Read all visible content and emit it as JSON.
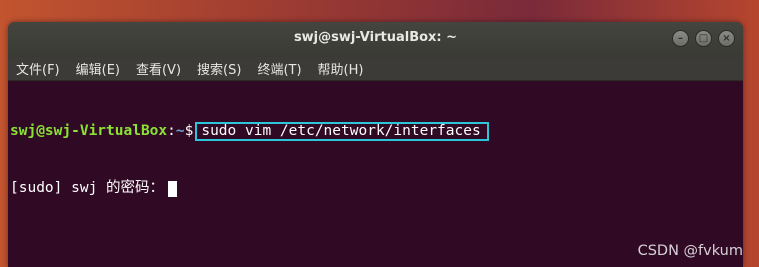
{
  "window": {
    "title": "swj@swj-VirtualBox: ~",
    "buttons": {
      "minimize": "–",
      "maximize": "□",
      "close": "×"
    }
  },
  "menu": [
    "文件(F)",
    "编辑(E)",
    "查看(V)",
    "搜索(S)",
    "终端(T)",
    "帮助(H)"
  ],
  "terminal": {
    "prompt_user": "swj@swj-VirtualBox",
    "prompt_sep": ":",
    "prompt_path": "~",
    "prompt_symbol": "$",
    "command": "sudo vim /etc/network/interfaces",
    "password_prompt": "[sudo] swj 的密码："
  },
  "watermark": "CSDN @fvkum",
  "colors": {
    "terminal_bg": "#300a24",
    "prompt_user": "#8ae234",
    "prompt_path": "#729fcf",
    "highlight_box": "#2cc6d8"
  },
  "icons": {
    "window_buttons": [
      "minimize-icon",
      "maximize-icon",
      "close-icon"
    ]
  }
}
